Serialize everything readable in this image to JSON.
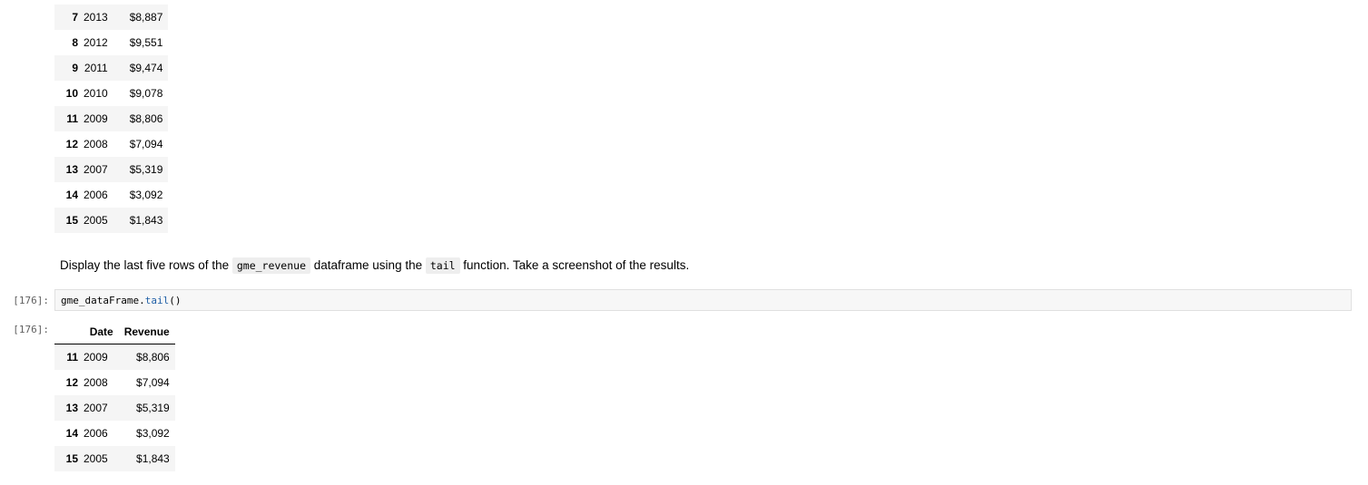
{
  "top_table": {
    "rows": [
      {
        "index": "7",
        "date": "2013",
        "revenue": "$8,887"
      },
      {
        "index": "8",
        "date": "2012",
        "revenue": "$9,551"
      },
      {
        "index": "9",
        "date": "2011",
        "revenue": "$9,474"
      },
      {
        "index": "10",
        "date": "2010",
        "revenue": "$9,078"
      },
      {
        "index": "11",
        "date": "2009",
        "revenue": "$8,806"
      },
      {
        "index": "12",
        "date": "2008",
        "revenue": "$7,094"
      },
      {
        "index": "13",
        "date": "2007",
        "revenue": "$5,319"
      },
      {
        "index": "14",
        "date": "2006",
        "revenue": "$3,092"
      },
      {
        "index": "15",
        "date": "2005",
        "revenue": "$1,843"
      }
    ]
  },
  "markdown": {
    "text_before": "Display the last five rows of the ",
    "code_1": "gme_revenue",
    "text_middle": " dataframe using the ",
    "code_2": "tail",
    "text_after": " function. Take a screenshot of the results."
  },
  "code_cell": {
    "prompt": "[176]:",
    "var": "gme_dataFrame",
    "dot": ".",
    "method": "tail",
    "parens": "()"
  },
  "output_cell": {
    "prompt": "[176]:",
    "columns": [
      "Date",
      "Revenue"
    ],
    "rows": [
      {
        "index": "11",
        "date": "2009",
        "revenue": "$8,806"
      },
      {
        "index": "12",
        "date": "2008",
        "revenue": "$7,094"
      },
      {
        "index": "13",
        "date": "2007",
        "revenue": "$5,319"
      },
      {
        "index": "14",
        "date": "2006",
        "revenue": "$3,092"
      },
      {
        "index": "15",
        "date": "2005",
        "revenue": "$1,843"
      }
    ]
  }
}
